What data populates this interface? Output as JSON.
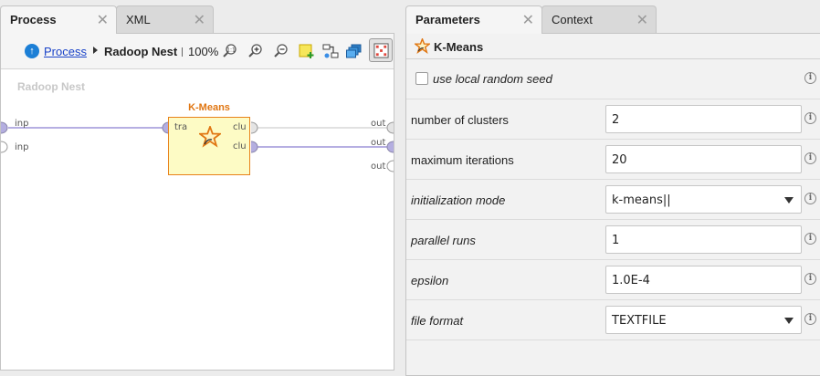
{
  "left_tabs": [
    {
      "label": "Process",
      "active": true
    },
    {
      "label": "XML",
      "active": false
    }
  ],
  "breadcrumb": {
    "link": "Process",
    "current": "Radoop Nest"
  },
  "zoom": "100%",
  "toolbar_icons": [
    "zoom-fit-icon",
    "zoom-in-icon",
    "zoom-out-icon",
    "add-note-icon",
    "auto-wire-icon",
    "layers-icon",
    "arrange-icon"
  ],
  "canvas": {
    "title": "Radoop Nest",
    "left_ports": [
      "inp",
      "inp"
    ],
    "right_ports": [
      "out",
      "out",
      "out"
    ],
    "operator": {
      "name": "K-Means",
      "input_port": "tra",
      "output_ports": [
        "clu",
        "clu"
      ]
    }
  },
  "right_tabs": [
    {
      "label": "Parameters",
      "active": true
    },
    {
      "label": "Context",
      "active": false
    }
  ],
  "parameters": {
    "operator_name": "K-Means",
    "checkbox": {
      "label": "use local random seed",
      "checked": false
    },
    "rows": [
      {
        "label": "number of clusters",
        "value": "2",
        "type": "input",
        "italic": false
      },
      {
        "label": "maximum iterations",
        "value": "20",
        "type": "input",
        "italic": false
      },
      {
        "label": "initialization mode",
        "value": "k-means||",
        "type": "select",
        "italic": true
      },
      {
        "label": "parallel runs",
        "value": "1",
        "type": "input",
        "italic": true
      },
      {
        "label": "epsilon",
        "value": "1.0E-4",
        "type": "input",
        "italic": true
      },
      {
        "label": "file format",
        "value": "TEXTFILE",
        "type": "select",
        "italic": true
      }
    ]
  },
  "colors": {
    "accent_orange": "#e07612",
    "operator_fill": "#fdfbc5",
    "link_blue": "#1a43c8",
    "port_purple": "#b4aee0",
    "wire_purple": "#8a7fd0"
  }
}
